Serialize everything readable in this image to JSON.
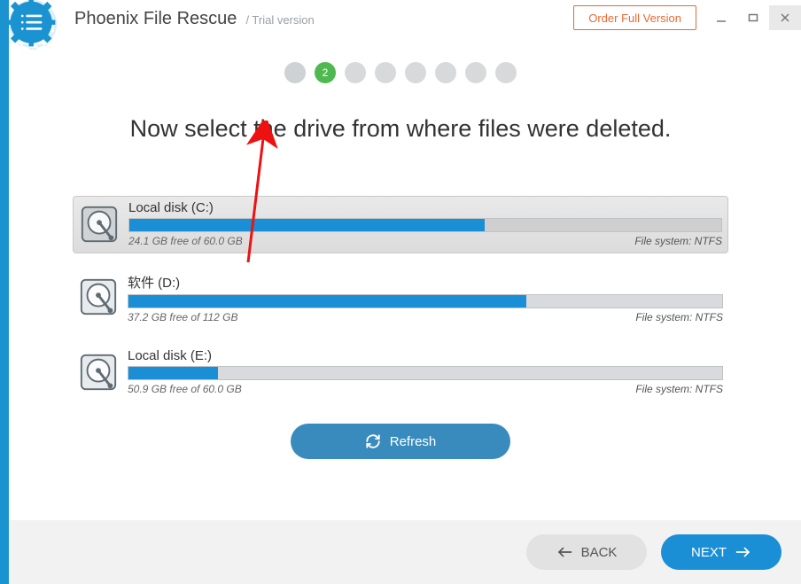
{
  "header": {
    "app_title": "Phoenix File Rescue",
    "subtitle": "/ Trial version",
    "order_button": "Order Full Version"
  },
  "steps": {
    "count": 8,
    "active_index": 1,
    "active_label": "2"
  },
  "main": {
    "heading": "Now select the drive from where files were deleted.",
    "refresh_label": "Refresh"
  },
  "drives": [
    {
      "name": "Local disk (C:)",
      "free_text": "24.1 GB free of 60.0 GB",
      "fs_text": "File system: NTFS",
      "used_percent": 60,
      "selected": true
    },
    {
      "name": "软件 (D:)",
      "free_text": "37.2 GB free of 112 GB",
      "fs_text": "File system: NTFS",
      "used_percent": 67,
      "selected": false
    },
    {
      "name": "Local disk (E:)",
      "free_text": "50.9 GB free of 60.0 GB",
      "fs_text": "File system: NTFS",
      "used_percent": 15,
      "selected": false
    }
  ],
  "footer": {
    "back_label": "BACK",
    "next_label": "NEXT"
  },
  "colors": {
    "accent": "#1a8fd6",
    "step_active": "#4fb84f",
    "order": "#e86a33"
  }
}
